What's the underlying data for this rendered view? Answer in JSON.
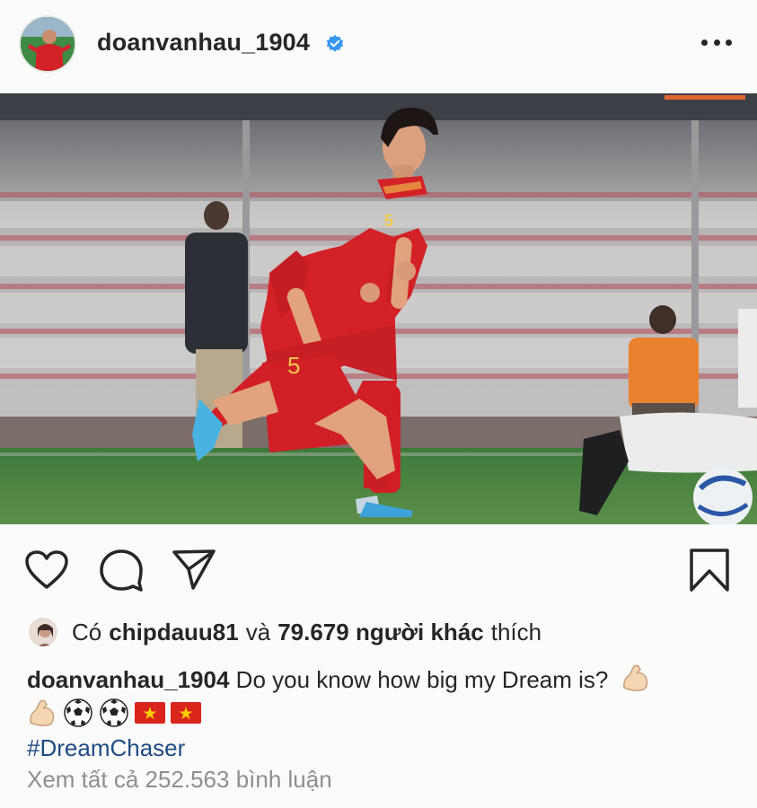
{
  "post": {
    "username": "doanvanhau_1904",
    "verified": true
  },
  "likes": {
    "prefix": "Có",
    "liked_by": "chipdauu81",
    "conjunction": "và",
    "others_count": "79.679 người khác",
    "suffix": "thích"
  },
  "caption": {
    "username": "doanvanhau_1904",
    "text": "Do you know how big my Dream is?",
    "emojis": [
      "flexed-biceps",
      "flexed-biceps",
      "soccer-ball",
      "soccer-ball",
      "vietnam-flag",
      "vietnam-flag"
    ],
    "hashtag": "#DreamChaser"
  },
  "comments": {
    "view_all": "Xem tất cả 252.563 bình luận"
  },
  "icons": {
    "like": "heart-icon",
    "comment": "comment-bubble-icon",
    "share": "paper-plane-icon",
    "save": "bookmark-icon",
    "more": "more-options-icon",
    "verified": "verified-badge-icon"
  },
  "photo": {
    "jersey_number": "5"
  },
  "colors": {
    "text": "#262626",
    "muted": "#8e8e8e",
    "hashtag": "#1f4b84",
    "verified": "#3897f0",
    "jersey": "#d32128"
  }
}
